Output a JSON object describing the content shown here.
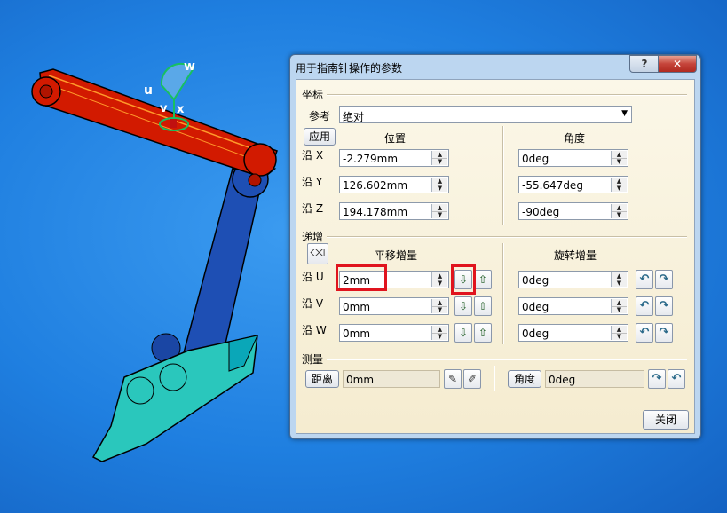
{
  "dialog": {
    "title": "用于指南针操作的参数",
    "help": "?",
    "close": "✕"
  },
  "coords": {
    "section": "坐标",
    "reference_label": "参考",
    "reference_value": "绝对",
    "apply_button": "应用",
    "position_header": "位置",
    "angle_header": "角度",
    "rows": [
      {
        "axis": "沿 X",
        "position": "-2.279mm",
        "angle": "0deg"
      },
      {
        "axis": "沿 Y",
        "position": "126.602mm",
        "angle": "-55.647deg"
      },
      {
        "axis": "沿 Z",
        "position": "194.178mm",
        "angle": "-90deg"
      }
    ]
  },
  "increments": {
    "section": "递增",
    "translation_header": "平移增量",
    "rotation_header": "旋转增量",
    "rows": [
      {
        "axis": "沿 U",
        "translation": "2mm",
        "rotation": "0deg"
      },
      {
        "axis": "沿 V",
        "translation": "0mm",
        "rotation": "0deg"
      },
      {
        "axis": "沿 W",
        "translation": "0mm",
        "rotation": "0deg"
      }
    ]
  },
  "measure": {
    "section": "测量",
    "distance_button": "距离",
    "distance_value": "0mm",
    "angle_button": "角度",
    "angle_value": "0deg"
  },
  "footer": {
    "close_button": "关闭"
  },
  "compass": {
    "u": "u",
    "v": "v",
    "w": "w",
    "x": "x"
  },
  "colors": {
    "arm_upper": "#d21a00",
    "arm_lower": "#1e4fb4",
    "base": "#2ac7bc",
    "background": "#1f7fe0"
  }
}
